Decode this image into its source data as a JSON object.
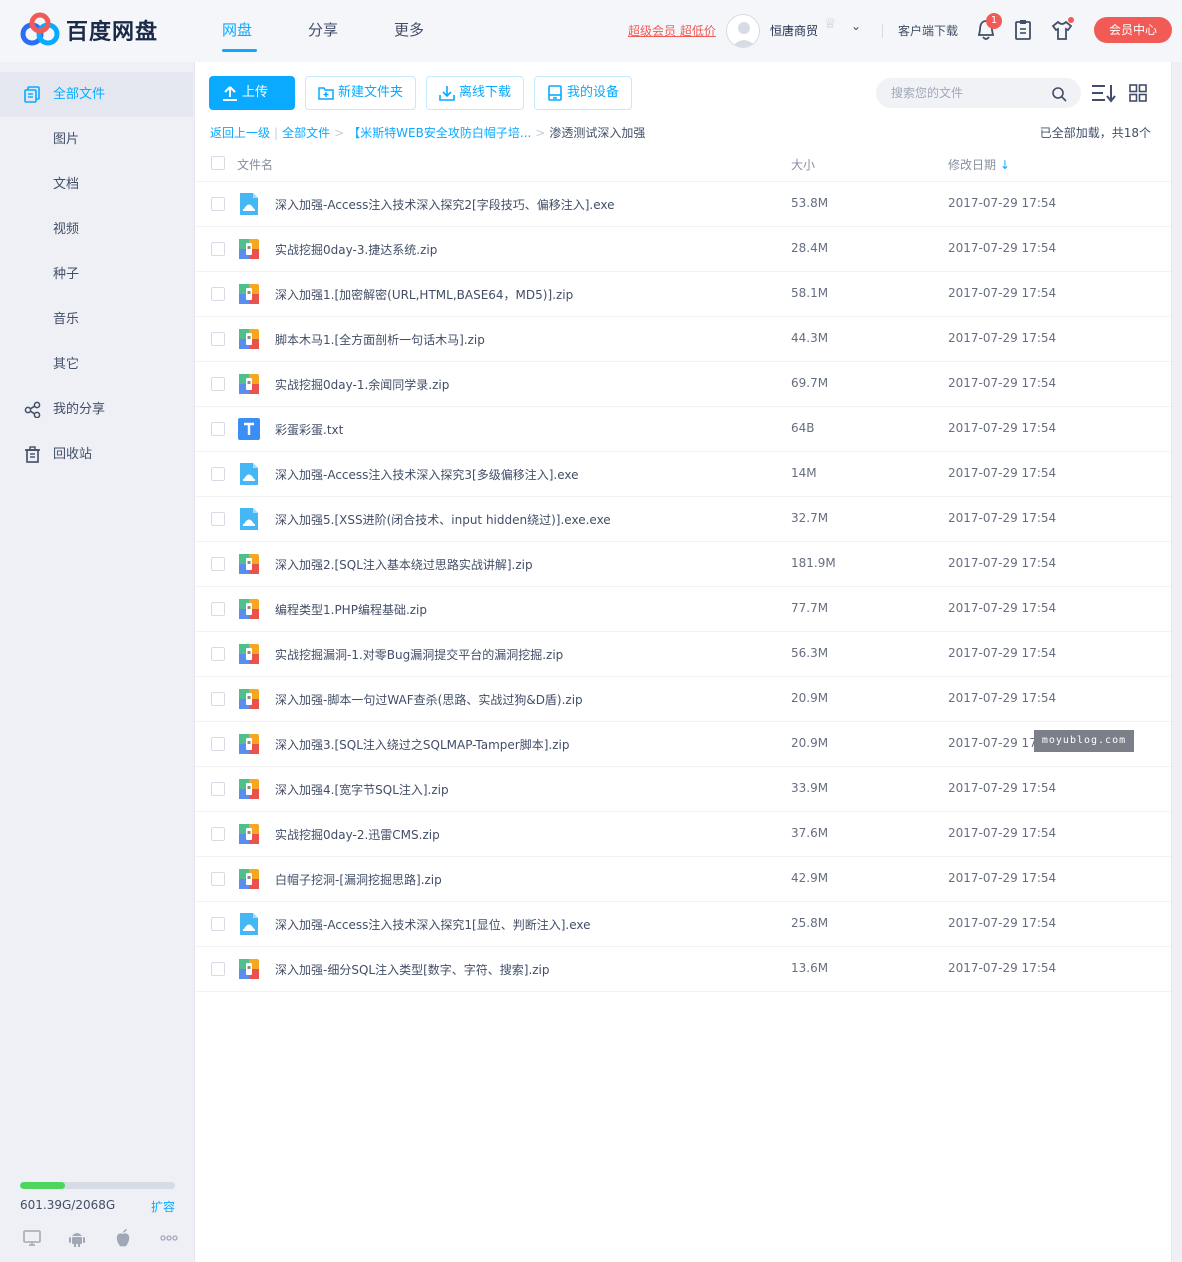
{
  "header": {
    "logo_text": "百度网盘",
    "nav": [
      {
        "label": "网盘",
        "active": true
      },
      {
        "label": "分享",
        "active": false
      },
      {
        "label": "更多",
        "active": false
      }
    ],
    "vip_promo": "超级会员 超低价",
    "user_name": "恒唐商贸",
    "client_download": "客户端下载",
    "notification_count": "1",
    "member_center": "会员中心"
  },
  "sidebar": {
    "items": [
      {
        "label": "全部文件",
        "icon": "files-icon",
        "active": true
      },
      {
        "label": "图片"
      },
      {
        "label": "文档"
      },
      {
        "label": "视频"
      },
      {
        "label": "种子"
      },
      {
        "label": "音乐"
      },
      {
        "label": "其它"
      },
      {
        "label": "我的分享",
        "icon": "share-icon"
      },
      {
        "label": "回收站",
        "icon": "trash-icon"
      }
    ],
    "quota": {
      "used_fraction": 0.29,
      "text": "601.39G/2068G",
      "expand_label": "扩容"
    },
    "platforms": [
      "desktop-icon",
      "android-icon",
      "apple-icon",
      "more-icon"
    ]
  },
  "toolbar": {
    "upload_label": "上传",
    "new_folder_label": "新建文件夹",
    "offline_download_label": "离线下载",
    "my_devices_label": "我的设备",
    "search_placeholder": "搜索您的文件"
  },
  "breadcrumb": {
    "back": "返回上一级",
    "root": "全部文件",
    "folder": "【米斯特WEB安全攻防白帽子培...",
    "current": "渗透测试深入加强",
    "status": "已全部加载，共18个"
  },
  "table": {
    "col_name": "文件名",
    "col_size": "大小",
    "col_date": "修改日期",
    "rows": [
      {
        "name": "深入加强-Access注入技术深入探究2[字段技巧、偏移注入].exe",
        "size": "53.8M",
        "date": "2017-07-29 17:54",
        "type": "exe"
      },
      {
        "name": "实战挖掘0day-3.捷达系统.zip",
        "size": "28.4M",
        "date": "2017-07-29 17:54",
        "type": "zip"
      },
      {
        "name": "深入加强1.[加密解密(URL,HTML,BASE64，MD5)].zip",
        "size": "58.1M",
        "date": "2017-07-29 17:54",
        "type": "zip"
      },
      {
        "name": "脚本木马1.[全方面剖析一句话木马].zip",
        "size": "44.3M",
        "date": "2017-07-29 17:54",
        "type": "zip"
      },
      {
        "name": "实战挖掘0day-1.余闻同学录.zip",
        "size": "69.7M",
        "date": "2017-07-29 17:54",
        "type": "zip"
      },
      {
        "name": "彩蛋彩蛋.txt",
        "size": "64B",
        "date": "2017-07-29 17:54",
        "type": "txt"
      },
      {
        "name": "深入加强-Access注入技术深入探究3[多级偏移注入].exe",
        "size": "14M",
        "date": "2017-07-29 17:54",
        "type": "exe"
      },
      {
        "name": "深入加强5.[XSS进阶(闭合技术、input hidden绕过)].exe.exe",
        "size": "32.7M",
        "date": "2017-07-29 17:54",
        "type": "exe"
      },
      {
        "name": "深入加强2.[SQL注入基本绕过思路实战讲解].zip",
        "size": "181.9M",
        "date": "2017-07-29 17:54",
        "type": "zip"
      },
      {
        "name": "编程类型1.PHP编程基础.zip",
        "size": "77.7M",
        "date": "2017-07-29 17:54",
        "type": "zip"
      },
      {
        "name": "实战挖掘漏洞-1.对零Bug漏洞提交平台的漏洞挖掘.zip",
        "size": "56.3M",
        "date": "2017-07-29 17:54",
        "type": "zip"
      },
      {
        "name": "深入加强-脚本一句过WAF查杀(思路、实战过狗&D盾).zip",
        "size": "20.9M",
        "date": "2017-07-29 17:54",
        "type": "zip"
      },
      {
        "name": "深入加强3.[SQL注入绕过之SQLMAP-Tamper脚本].zip",
        "size": "20.9M",
        "date": "2017-07-29 17:54",
        "type": "zip"
      },
      {
        "name": "深入加强4.[宽字节SQL注入].zip",
        "size": "33.9M",
        "date": "2017-07-29 17:54",
        "type": "zip"
      },
      {
        "name": "实战挖掘0day-2.迅雷CMS.zip",
        "size": "37.6M",
        "date": "2017-07-29 17:54",
        "type": "zip"
      },
      {
        "name": "白帽子挖洞-[漏洞挖掘思路].zip",
        "size": "42.9M",
        "date": "2017-07-29 17:54",
        "type": "zip"
      },
      {
        "name": "深入加强-Access注入技术深入探究1[显位、判断注入].exe",
        "size": "25.8M",
        "date": "2017-07-29 17:54",
        "type": "exe"
      },
      {
        "name": "深入加强-细分SQL注入类型[数字、字符、搜索].zip",
        "size": "13.6M",
        "date": "2017-07-29 17:54",
        "type": "zip"
      }
    ]
  },
  "watermark": "moyublog.com",
  "colors": {
    "accent": "#09aaff",
    "danger": "#f25a55",
    "quota": "#4ed55d"
  }
}
